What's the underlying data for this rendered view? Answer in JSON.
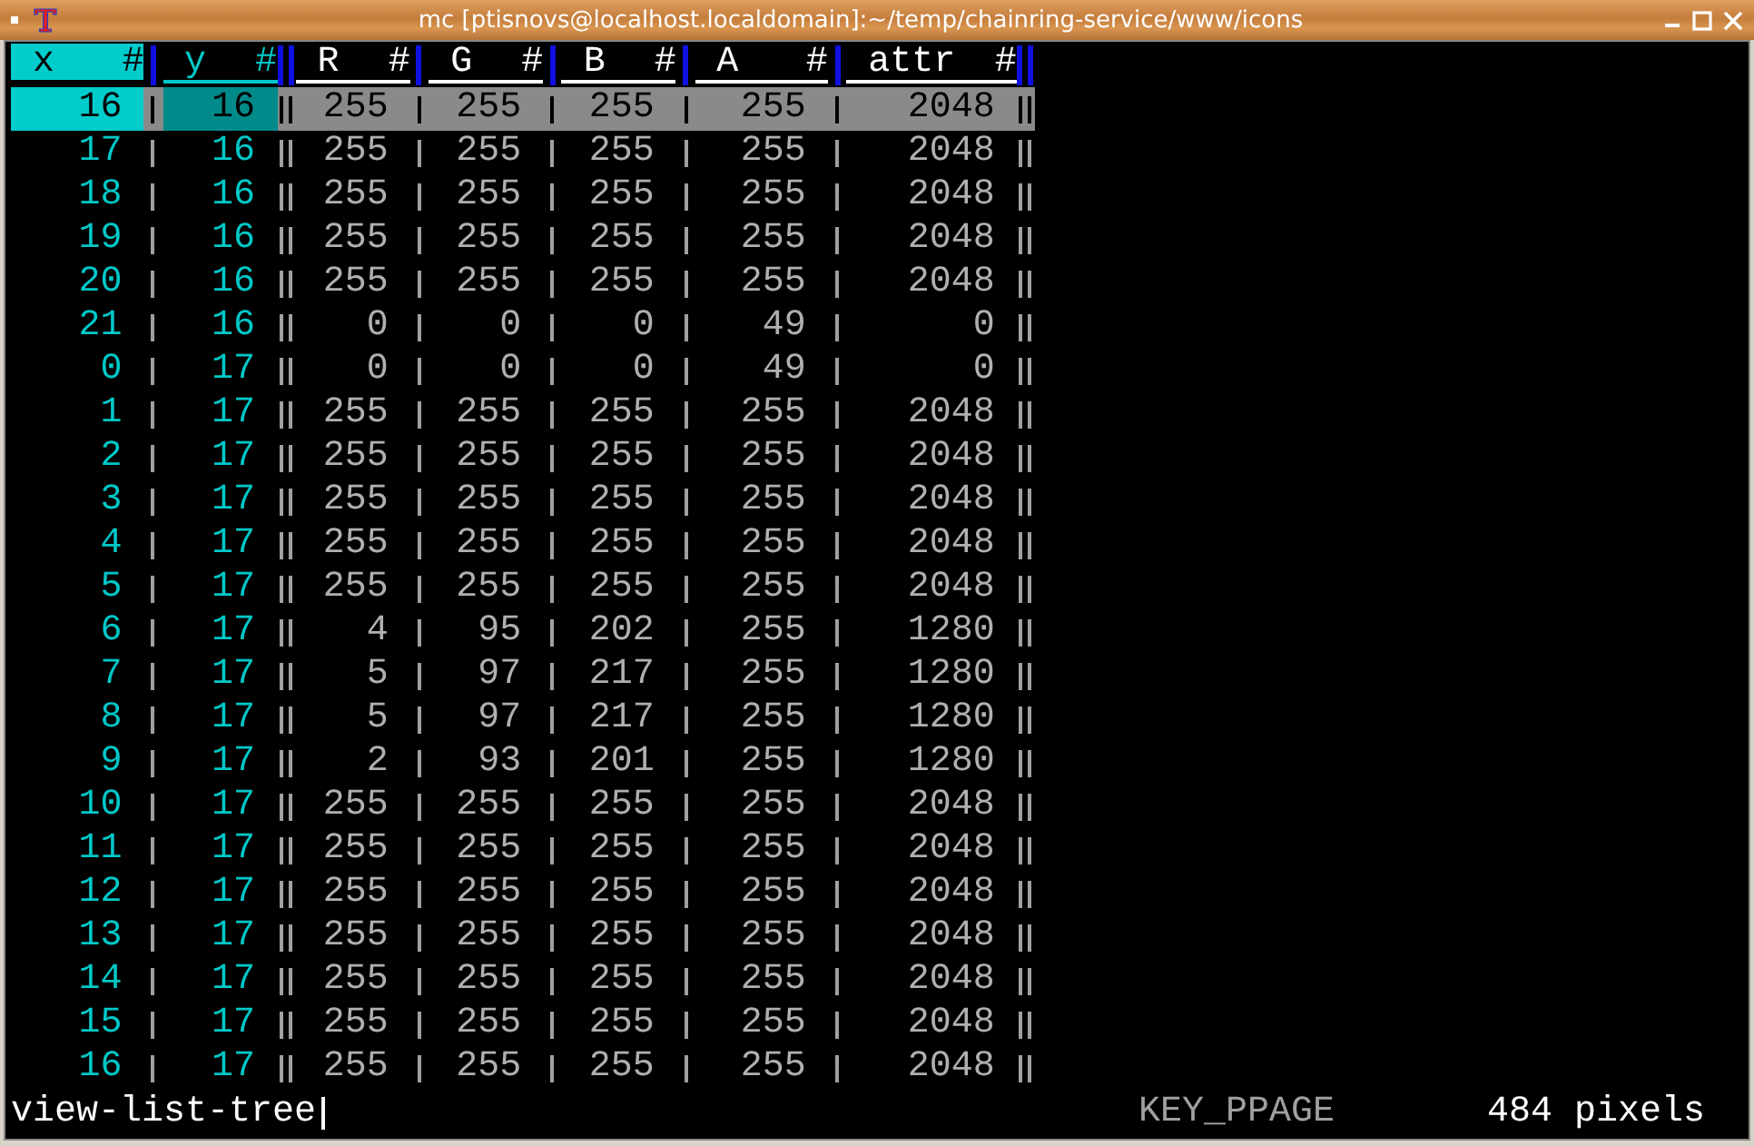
{
  "window": {
    "title": "mc [ptisnovs@localhost.localdomain]:~/temp/chainring-service/www/icons"
  },
  "table": {
    "columns": [
      {
        "label": "x",
        "marker": "#",
        "selected": true
      },
      {
        "label": "y",
        "marker": "#",
        "selected": false
      },
      {
        "label": "R",
        "marker": "#",
        "selected": false
      },
      {
        "label": "G",
        "marker": "#",
        "selected": false
      },
      {
        "label": "B",
        "marker": "#",
        "selected": false
      },
      {
        "label": "A",
        "marker": "#",
        "selected": false
      },
      {
        "label": "attr",
        "marker": "#",
        "selected": false
      }
    ],
    "rows": [
      {
        "cells": [
          "16",
          "16",
          "255",
          "255",
          "255",
          "255",
          "2048"
        ],
        "selected": true
      },
      {
        "cells": [
          "17",
          "16",
          "255",
          "255",
          "255",
          "255",
          "2048"
        ],
        "selected": false
      },
      {
        "cells": [
          "18",
          "16",
          "255",
          "255",
          "255",
          "255",
          "2048"
        ],
        "selected": false
      },
      {
        "cells": [
          "19",
          "16",
          "255",
          "255",
          "255",
          "255",
          "2048"
        ],
        "selected": false
      },
      {
        "cells": [
          "20",
          "16",
          "255",
          "255",
          "255",
          "255",
          "2048"
        ],
        "selected": false
      },
      {
        "cells": [
          "21",
          "16",
          "0",
          "0",
          "0",
          "49",
          "0"
        ],
        "selected": false
      },
      {
        "cells": [
          "0",
          "17",
          "0",
          "0",
          "0",
          "49",
          "0"
        ],
        "selected": false
      },
      {
        "cells": [
          "1",
          "17",
          "255",
          "255",
          "255",
          "255",
          "2048"
        ],
        "selected": false
      },
      {
        "cells": [
          "2",
          "17",
          "255",
          "255",
          "255",
          "255",
          "2048"
        ],
        "selected": false
      },
      {
        "cells": [
          "3",
          "17",
          "255",
          "255",
          "255",
          "255",
          "2048"
        ],
        "selected": false
      },
      {
        "cells": [
          "4",
          "17",
          "255",
          "255",
          "255",
          "255",
          "2048"
        ],
        "selected": false
      },
      {
        "cells": [
          "5",
          "17",
          "255",
          "255",
          "255",
          "255",
          "2048"
        ],
        "selected": false
      },
      {
        "cells": [
          "6",
          "17",
          "4",
          "95",
          "202",
          "255",
          "1280"
        ],
        "selected": false
      },
      {
        "cells": [
          "7",
          "17",
          "5",
          "97",
          "217",
          "255",
          "1280"
        ],
        "selected": false
      },
      {
        "cells": [
          "8",
          "17",
          "5",
          "97",
          "217",
          "255",
          "1280"
        ],
        "selected": false
      },
      {
        "cells": [
          "9",
          "17",
          "2",
          "93",
          "201",
          "255",
          "1280"
        ],
        "selected": false
      },
      {
        "cells": [
          "10",
          "17",
          "255",
          "255",
          "255",
          "255",
          "2048"
        ],
        "selected": false
      },
      {
        "cells": [
          "11",
          "17",
          "255",
          "255",
          "255",
          "255",
          "2048"
        ],
        "selected": false
      },
      {
        "cells": [
          "12",
          "17",
          "255",
          "255",
          "255",
          "255",
          "2048"
        ],
        "selected": false
      },
      {
        "cells": [
          "13",
          "17",
          "255",
          "255",
          "255",
          "255",
          "2048"
        ],
        "selected": false
      },
      {
        "cells": [
          "14",
          "17",
          "255",
          "255",
          "255",
          "255",
          "2048"
        ],
        "selected": false
      },
      {
        "cells": [
          "15",
          "17",
          "255",
          "255",
          "255",
          "255",
          "2048"
        ],
        "selected": false
      },
      {
        "cells": [
          "16",
          "17",
          "255",
          "255",
          "255",
          "255",
          "2048"
        ],
        "selected": false
      }
    ]
  },
  "status_bar": {
    "mode": "view-list-tree",
    "key": "KEY_PPAGE",
    "size": "484 pixels"
  }
}
